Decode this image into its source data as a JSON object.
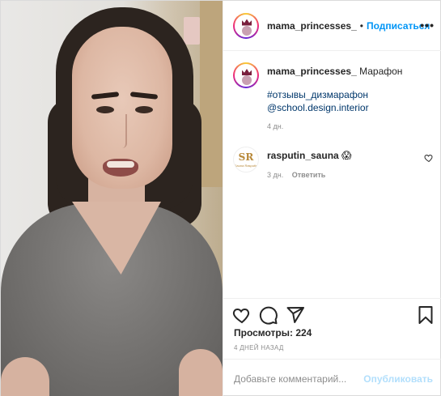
{
  "header": {
    "username": "mama_princesses_",
    "separator": "•",
    "follow_label": "Подписаться",
    "more_label": "•••"
  },
  "caption": {
    "username": "mama_princesses_",
    "text": "Марафон",
    "hashtag": "#отзывы_дизмарафон",
    "mention": "@school.design.interior",
    "time": "4 дн."
  },
  "comments": [
    {
      "username": "rasputin_sauna",
      "text": "😱",
      "time": "3 дн.",
      "reply_label": "Ответить",
      "avatar_text": "SR",
      "avatar_subtext": "Sauna Rasputin"
    }
  ],
  "stats": {
    "views": "Просмотры: 224",
    "posted_ago": "4 ДНЕЙ НАЗАД"
  },
  "add_comment": {
    "placeholder": "Добавьте комментарий...",
    "publish_label": "Опубликовать"
  },
  "colors": {
    "link": "#00376b",
    "accent": "#0095f6",
    "publish_disabled": "#b2dffc",
    "muted": "#8e8e8e"
  }
}
